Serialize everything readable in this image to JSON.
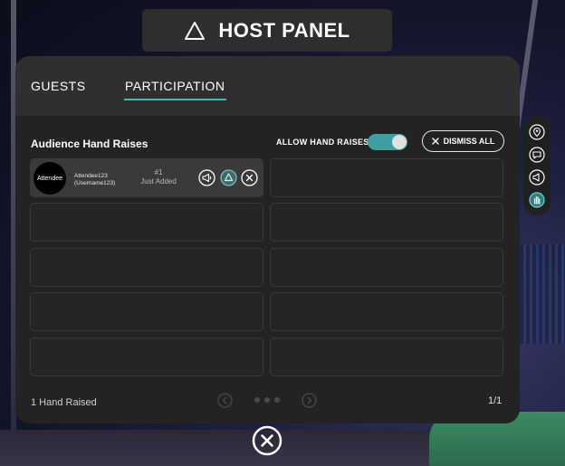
{
  "header": {
    "title": "HOST PANEL",
    "icon": "triangle-icon"
  },
  "tabs": [
    {
      "label": "GUESTS",
      "active": false
    },
    {
      "label": "PARTICIPATION",
      "active": true
    }
  ],
  "participation": {
    "section_title": "Audience Hand Raises",
    "allow_label": "ALLOW HAND RAISES",
    "allow_enabled": true,
    "dismiss_all_label": "DISMISS ALL",
    "attendees": [
      {
        "avatar_label": "Attendee",
        "name": "Attendee123",
        "username": "(Username123)",
        "rank": "#1",
        "status": "Just Added"
      }
    ],
    "footer_count": "1 Hand Raised",
    "page_indicator": "1/1"
  },
  "colors": {
    "accent": "#4fb3b3",
    "toggle_on": "#3f9ea2",
    "panel_bg": "#232323",
    "tab_bar_bg": "#2f2f2f"
  },
  "side_rail": {
    "icons": [
      "pin-icon",
      "chat-icon",
      "megaphone-icon",
      "hand-raise-icon"
    ],
    "active": "hand-raise-icon"
  }
}
